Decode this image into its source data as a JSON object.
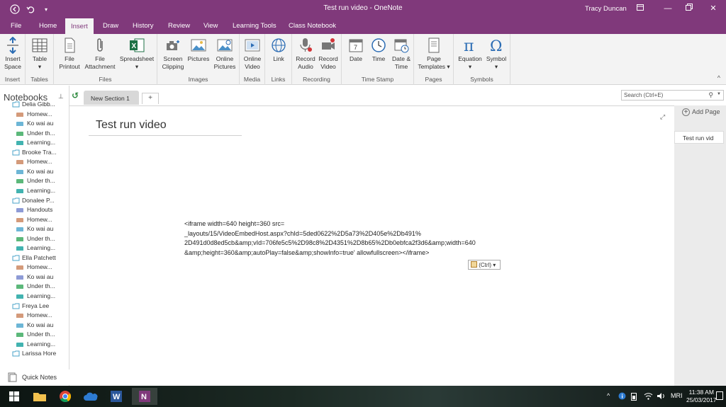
{
  "window": {
    "title": "Test run video - OneNote",
    "user": "Tracy Duncan"
  },
  "tabs": [
    "File",
    "Home",
    "Insert",
    "Draw",
    "History",
    "Review",
    "View",
    "Learning Tools",
    "Class Notebook"
  ],
  "active_tab": "Insert",
  "ribbon": {
    "groups": {
      "insert": "Insert",
      "tables": "Tables",
      "files": "Files",
      "images": "Images",
      "media": "Media",
      "links": "Links",
      "recording": "Recording",
      "timestamp": "Time Stamp",
      "pages": "Pages",
      "symbols": "Symbols"
    },
    "buttons": {
      "insert_space": [
        "Insert",
        "Space"
      ],
      "table": [
        "Table",
        "▾"
      ],
      "file_printout": [
        "File",
        "Printout"
      ],
      "file_attachment": [
        "File",
        "Attachment"
      ],
      "spreadsheet": [
        "Spreadsheet",
        "▾"
      ],
      "screen_clipping": [
        "Screen",
        "Clipping"
      ],
      "pictures": [
        "Pictures",
        ""
      ],
      "online_pictures": [
        "Online",
        "Pictures"
      ],
      "online_video": [
        "Online",
        "Video"
      ],
      "link": [
        "Link",
        ""
      ],
      "record_audio": [
        "Record",
        "Audio"
      ],
      "record_video": [
        "Record",
        "Video"
      ],
      "date": [
        "Date",
        ""
      ],
      "time": [
        "Time",
        ""
      ],
      "date_time": [
        "Date &",
        "Time"
      ],
      "page_templates": [
        "Page",
        "Templates ▾"
      ],
      "equation": [
        "Equation",
        "▾"
      ],
      "symbol": [
        "Symbol",
        "▾"
      ]
    }
  },
  "notebooks_pane": {
    "heading": "Notebooks",
    "items": [
      {
        "type": "notebook",
        "label": "Delia Gibb...",
        "color": "#4aa3c9"
      },
      {
        "type": "section",
        "label": "Homew...",
        "color": "#d49a7a"
      },
      {
        "type": "section",
        "label": "Ko wai au",
        "color": "#6db6d6"
      },
      {
        "type": "section",
        "label": "Under th...",
        "color": "#5cb87a"
      },
      {
        "type": "section",
        "label": "Learning...",
        "color": "#42b3b0"
      },
      {
        "type": "notebook",
        "label": "Brooke Tra...",
        "color": "#4aa3c9"
      },
      {
        "type": "section",
        "label": "Homew...",
        "color": "#d49a7a"
      },
      {
        "type": "section",
        "label": "Ko wai au",
        "color": "#6db6d6"
      },
      {
        "type": "section",
        "label": "Under th...",
        "color": "#5cb87a"
      },
      {
        "type": "section",
        "label": "Learning...",
        "color": "#42b3b0"
      },
      {
        "type": "notebook",
        "label": "Donalee P...",
        "color": "#4aa3c9"
      },
      {
        "type": "section",
        "label": "Handouts",
        "color": "#8e9bd6"
      },
      {
        "type": "section",
        "label": "Homew...",
        "color": "#d49a7a"
      },
      {
        "type": "section",
        "label": "Ko wai au",
        "color": "#6db6d6"
      },
      {
        "type": "section",
        "label": "Under th...",
        "color": "#5cb87a"
      },
      {
        "type": "section",
        "label": "Learning...",
        "color": "#42b3b0"
      },
      {
        "type": "notebook",
        "label": "Ella Patchett",
        "color": "#4aa3c9"
      },
      {
        "type": "section",
        "label": "Homew...",
        "color": "#d49a7a"
      },
      {
        "type": "section",
        "label": "Ko wai au",
        "color": "#8e9bd6"
      },
      {
        "type": "section",
        "label": "Under th...",
        "color": "#5cb87a"
      },
      {
        "type": "section",
        "label": "Learning...",
        "color": "#42b3b0"
      },
      {
        "type": "notebook",
        "label": "Freya Lee",
        "color": "#4aa3c9"
      },
      {
        "type": "section",
        "label": "Homew...",
        "color": "#d49a7a"
      },
      {
        "type": "section",
        "label": "Ko wai au",
        "color": "#6db6d6"
      },
      {
        "type": "section",
        "label": "Under th...",
        "color": "#5cb87a"
      },
      {
        "type": "section",
        "label": "Learning...",
        "color": "#42b3b0"
      },
      {
        "type": "notebook",
        "label": "Larissa Hore",
        "color": "#4aa3c9"
      }
    ],
    "quick_notes": "Quick Notes"
  },
  "section_tabs": {
    "current": "New Section 1",
    "add": "+"
  },
  "search": {
    "placeholder": "Search (Ctrl+E)"
  },
  "page": {
    "title": "Test run video",
    "body_lines": [
      "<iframe width=640 height=360 src=",
      "_layouts/15/VideoEmbedHost.aspx?chId=5ded0622%2D5a73%2D405e%2Db491%",
      "2D491d0d8ed5cb&amp;vId=706fe5c5%2D98c8%2D4351%2D8b65%2Db0ebfca2f3d6&amp;width=640",
      "&amp;height=360&amp;autoPlay=false&amp;showInfo=true' allowfullscreen></iframe>"
    ],
    "paste_options": "(Ctrl) ▾"
  },
  "page_list": {
    "add_page": "Add Page",
    "pages": [
      "Test run vid"
    ]
  },
  "taskbar": {
    "language": "MRI",
    "time": "11:38 AM",
    "date": "25/03/2017"
  },
  "colors": {
    "accent": "#80397b",
    "ribbon_bg": "#f3f3f3"
  }
}
